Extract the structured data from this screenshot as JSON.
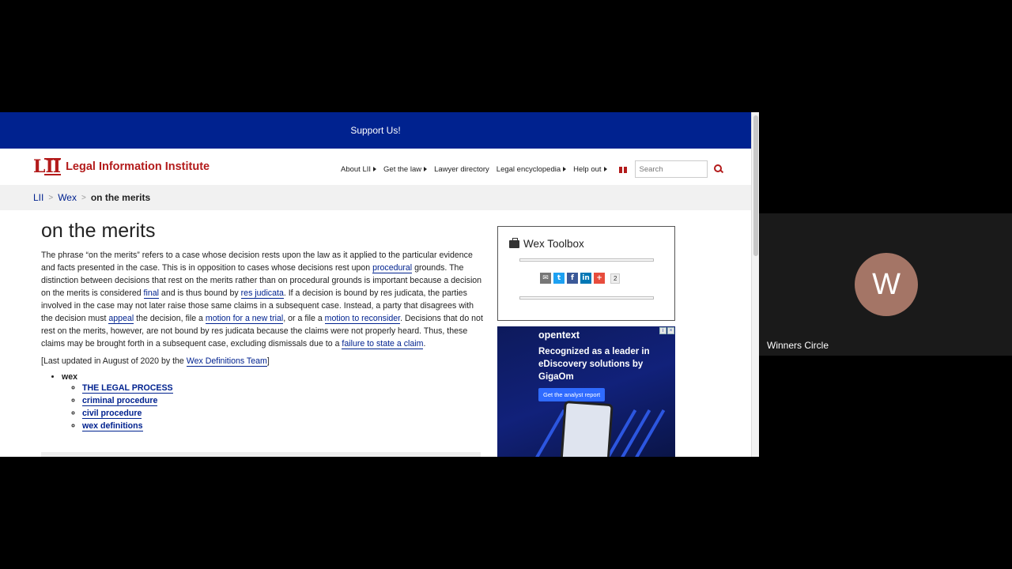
{
  "support": {
    "label": "Support Us!"
  },
  "logo": {
    "mark": "LII",
    "text": "Legal Information Institute"
  },
  "nav": {
    "items": [
      "About LII",
      "Get the law",
      "Lawyer directory",
      "Legal encyclopedia",
      "Help out"
    ],
    "search_placeholder": "Search"
  },
  "breadcrumb": {
    "items": [
      "LII",
      "Wex"
    ],
    "current": "on the merits"
  },
  "article": {
    "title": "on the merits",
    "p1": "The phrase “on the merits” refers to a case whose decision rests upon the law as it applied to the particular evidence and facts presented in the case. This is in opposition to cases whose decisions rest upon ",
    "link_procedural": "procedural",
    "p2": " grounds. The distinction between decisions that rest on the merits rather than on procedural grounds is important because a decision on the merits is considered ",
    "link_final": "final",
    "p3": " and is thus bound by ",
    "link_res_judicata": "res judicata",
    "p4": ". If a decision is bound by res judicata, the parties involved in the case may not later raise those same claims in a subsequent case. Instead, a party that disagrees with the decision must ",
    "link_appeal": "appeal",
    "p5": " the decision, file a ",
    "link_new_trial": "motion for a new trial",
    "p6": ", or a file a ",
    "link_reconsider": "motion to reconsider",
    "p7": ". Decisions that do not rest on the merits, however, are not bound by res judicata because the claims were not properly heard. Thus, these claims may be brought forth in a subsequent case, excluding dismissals due to a ",
    "link_failure": "failure to state a claim",
    "p8": ".",
    "updated_prefix": "[Last updated in August of 2020 by the ",
    "updated_link": "Wex Definitions Team",
    "updated_suffix": "]",
    "topic_root": "wex",
    "topics": [
      "THE LEGAL PROCESS",
      "criminal procedure",
      "civil procedure",
      "wex definitions"
    ]
  },
  "toolbox": {
    "title": "Wex Toolbox",
    "share_count": "2"
  },
  "ad": {
    "brand": "opentext",
    "headline": "Recognized as a leader in eDiscovery solutions by GigaOm",
    "cta": "Get the analyst report"
  },
  "participant": {
    "initial": "W",
    "name": "Winners Circle"
  },
  "colors": {
    "brand_red": "#b31b1b",
    "link_blue": "#00228f",
    "support_bar": "#00228f",
    "avatar": "#a47566"
  }
}
